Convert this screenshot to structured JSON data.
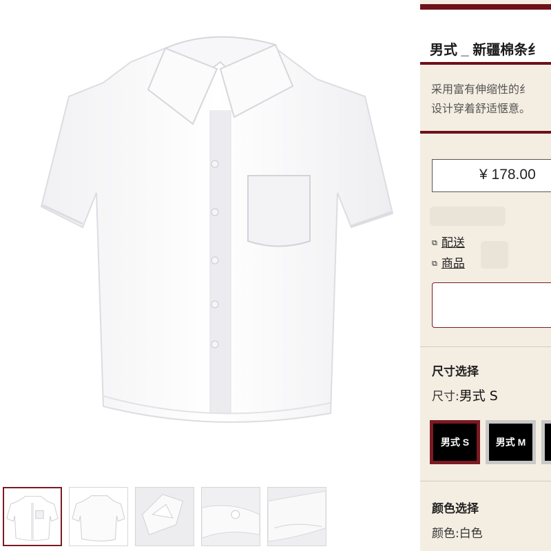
{
  "product": {
    "title": "男式 _ 新疆棉条纟",
    "description_lines": [
      "采用富有伸缩性的纟",
      "设计穿着舒适惬意。"
    ],
    "price": "¥ 178.00"
  },
  "shipping": {
    "delivery_label": "配送",
    "goods_label": "商品"
  },
  "size": {
    "section_title": "尺寸选择",
    "prefix": "尺寸:",
    "selected_value": "男式 S",
    "options": [
      "男式 S",
      "男式 M"
    ]
  },
  "color": {
    "section_title": "颜色选择",
    "prefix": "颜色:",
    "selected_value": "白色"
  },
  "colors": {
    "accent": "#6e1019",
    "panel_bg": "#f4ede2",
    "swatch_bg": "#000000"
  },
  "icons": {
    "info": "window-icon"
  }
}
